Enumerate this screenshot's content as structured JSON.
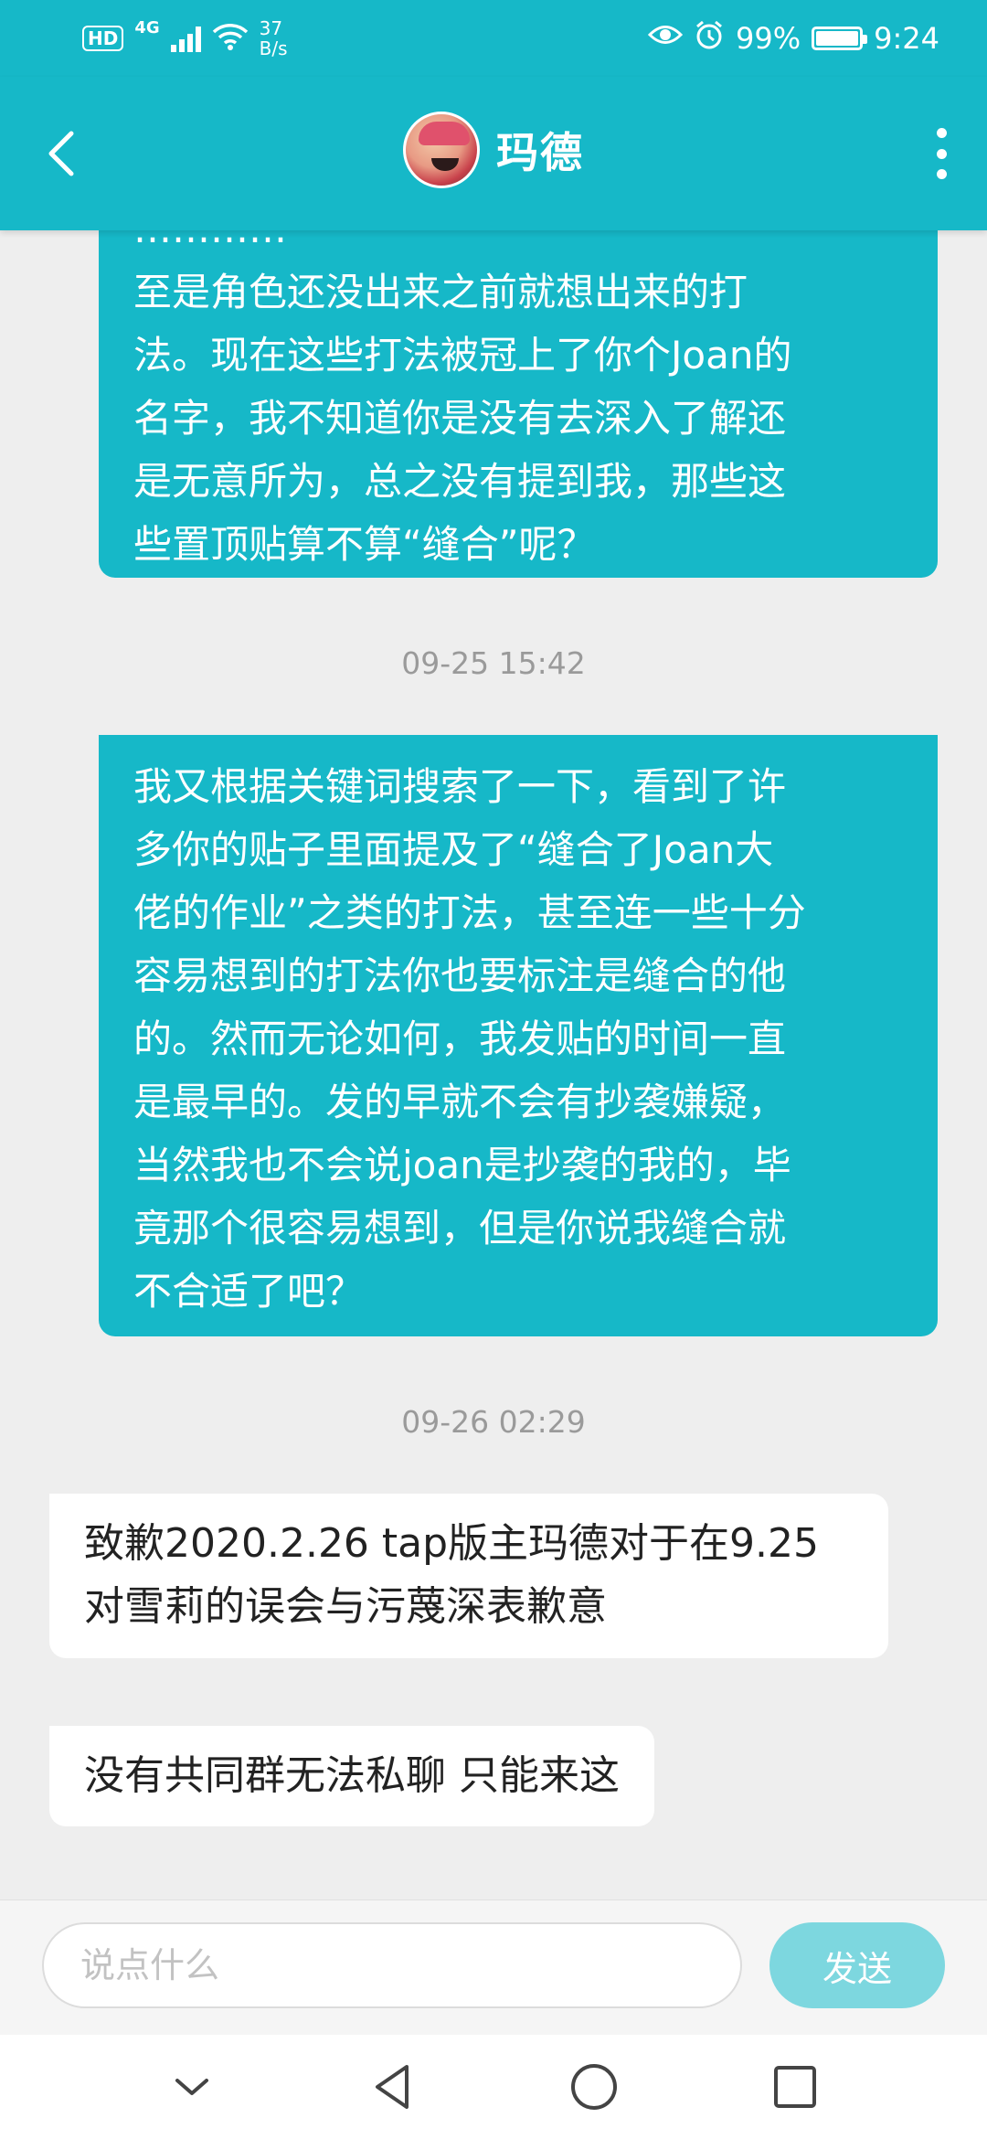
{
  "colors": {
    "accent": "#16b8c8",
    "accent_light": "#7dd7df"
  },
  "status_bar": {
    "hd": "HD",
    "network": "4G",
    "speed_value": "37",
    "speed_unit": "B/s",
    "battery": "99%",
    "battery_level": 0.99,
    "time": "9:24",
    "icons": [
      "eye-icon",
      "alarm-icon",
      "battery-icon",
      "wifi-icon",
      "signal-icon"
    ]
  },
  "header": {
    "title": "玛德",
    "icons": [
      "back-arrow-icon",
      "avatar",
      "more-vertical-icon"
    ]
  },
  "messages": [
    {
      "type": "sent",
      "text": "…………\n至是角色还没出来之前就想出来的打\n法。现在这些打法被冠上了你个Joan的\n名字，我不知道你是没有去深入了解还\n是无意所为，总之没有提到我，那些这\n些置顶贴算不算“缝合”呢？"
    },
    {
      "type": "timestamp",
      "text": "09-25 15:42"
    },
    {
      "type": "sent",
      "text": "我又根据关键词搜索了一下，看到了许\n多你的贴子里面提及了“缝合了Joan大\n佬的作业”之类的打法，甚至连一些十分\n容易想到的打法你也要标注是缝合的他\n的。然而无论如何，我发贴的时间一直\n是最早的。发的早就不会有抄袭嫌疑，\n当然我也不会说joan是抄袭的我的，毕\n竟那个很容易想到，但是你说我缝合就\n不合适了吧？"
    },
    {
      "type": "timestamp",
      "text": "09-26 02:29"
    },
    {
      "type": "received",
      "text": "致歉2020.2.26 tap版主玛德对于在9.25\n对雪莉的误会与污蔑深表歉意"
    },
    {
      "type": "received",
      "text": "没有共同群无法私聊 只能来这"
    }
  ],
  "input_bar": {
    "placeholder": "说点什么",
    "value": "",
    "send_label": "发送"
  },
  "nav_bar": {
    "icons": [
      "collapse-down-icon",
      "back-triangle-icon",
      "home-circle-icon",
      "recents-square-icon"
    ]
  }
}
